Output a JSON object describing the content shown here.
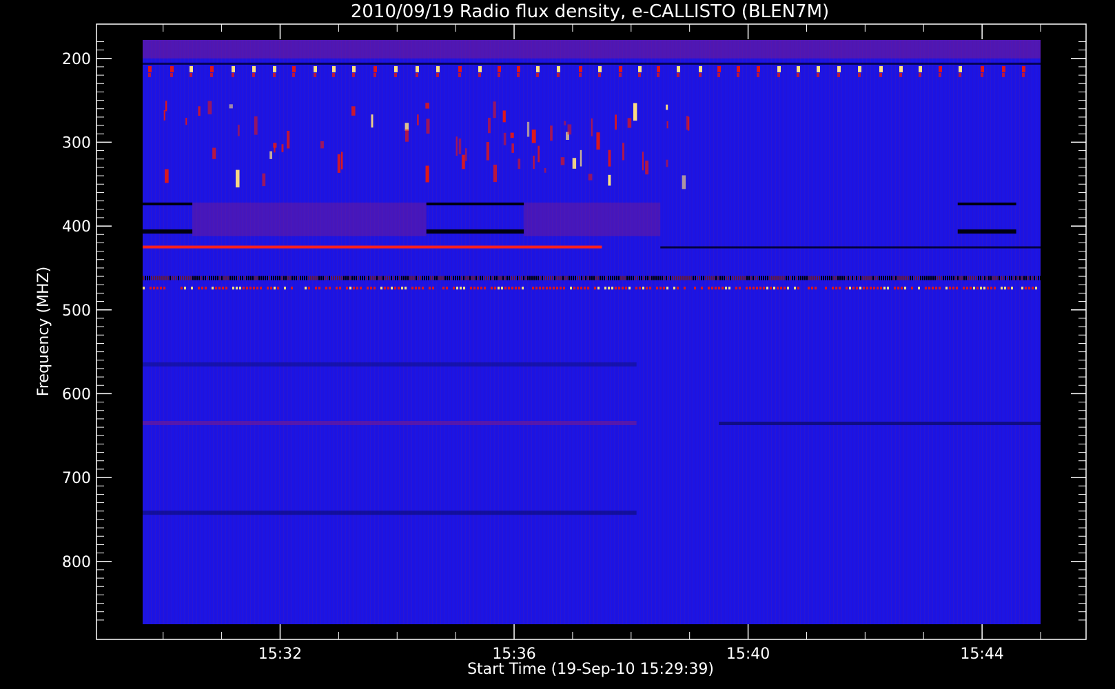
{
  "chart_data": {
    "type": "heatmap",
    "title": "2010/09/19  Radio flux density, e-CALLISTO (BLEN7M)",
    "xlabel": "Start Time (19-Sep-10 15:29:39)",
    "ylabel": "Frequency (MHZ)",
    "x_tick_labels": [
      "15:32",
      "15:36",
      "15:40",
      "15:44"
    ],
    "y_tick_labels": [
      "200",
      "300",
      "400",
      "500",
      "600",
      "700",
      "800"
    ],
    "x_range": [
      "15:29:39",
      "15:45:00"
    ],
    "y_range": [
      178,
      875
    ],
    "y_axis_direction": "frequency increasing downward",
    "colors": {
      "background": "#000000",
      "low": "#1a14e6",
      "mid": "#7a1a8c",
      "high": "#e01818",
      "peak": "#ffe080",
      "axis": "#ffffff"
    },
    "features": [
      {
        "kind": "narrow band emission",
        "frequency_mhz": 210
      },
      {
        "kind": "type III burst cluster",
        "frequency_range_mhz": [
          250,
          340
        ],
        "time_range": [
          "15:30",
          "15:39"
        ]
      },
      {
        "kind": "continuous red line",
        "frequency_mhz": 425,
        "time_range": [
          "15:29:39",
          "15:37:30"
        ]
      },
      {
        "kind": "dark band",
        "frequency_mhz": 462
      },
      {
        "kind": "dotted emission line",
        "frequency_mhz": 474
      }
    ]
  }
}
